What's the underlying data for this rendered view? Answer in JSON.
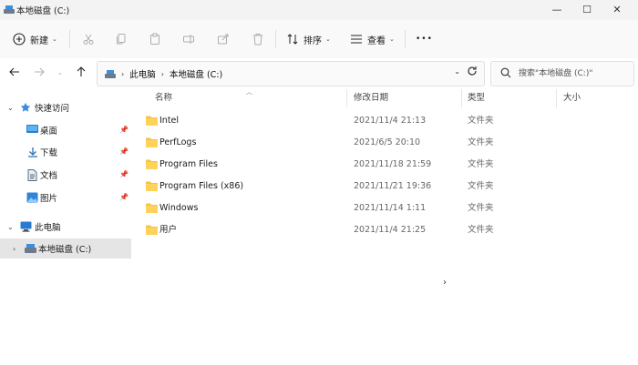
{
  "window": {
    "title": "本地磁盘 (C:)",
    "controls": {
      "minimize": "—",
      "maximize": "☐",
      "close": "✕"
    }
  },
  "toolbar": {
    "new_label": "新建",
    "sort_label": "排序",
    "view_label": "查看",
    "more_label": "•••",
    "icons": [
      "cut-icon",
      "copy-icon",
      "paste-icon",
      "rename-icon",
      "share-icon",
      "delete-icon"
    ]
  },
  "address": {
    "crumbs": [
      "此电脑",
      "本地磁盘 (C:)"
    ],
    "crumb_separator": "›"
  },
  "search": {
    "placeholder": "搜索\"本地磁盘 (C:)\""
  },
  "sidebar": {
    "quick_access": "快速访问",
    "items": [
      {
        "label": "桌面",
        "icon": "desktop-icon",
        "pinned": true
      },
      {
        "label": "下载",
        "icon": "download-icon",
        "pinned": true
      },
      {
        "label": "文档",
        "icon": "document-icon",
        "pinned": true
      },
      {
        "label": "图片",
        "icon": "pictures-icon",
        "pinned": true
      }
    ],
    "this_pc": "此电脑",
    "local_disk": "本地磁盘 (C:)"
  },
  "filelist": {
    "columns": {
      "name": "名称",
      "date": "修改日期",
      "type": "类型",
      "size": "大小"
    },
    "rows": [
      {
        "name": "Intel",
        "date": "2021/11/4 21:13",
        "type": "文件夹"
      },
      {
        "name": "PerfLogs",
        "date": "2021/6/5 20:10",
        "type": "文件夹"
      },
      {
        "name": "Program Files",
        "date": "2021/11/18 21:59",
        "type": "文件夹"
      },
      {
        "name": "Program Files (x86)",
        "date": "2021/11/21 19:36",
        "type": "文件夹"
      },
      {
        "name": "Windows",
        "date": "2021/11/14 1:11",
        "type": "文件夹"
      },
      {
        "name": "用户",
        "date": "2021/11/4 21:25",
        "type": "文件夹"
      }
    ]
  },
  "colors": {
    "folder": "#f6c342",
    "accent": "#0067c0",
    "selection": "#e5e5e5"
  }
}
